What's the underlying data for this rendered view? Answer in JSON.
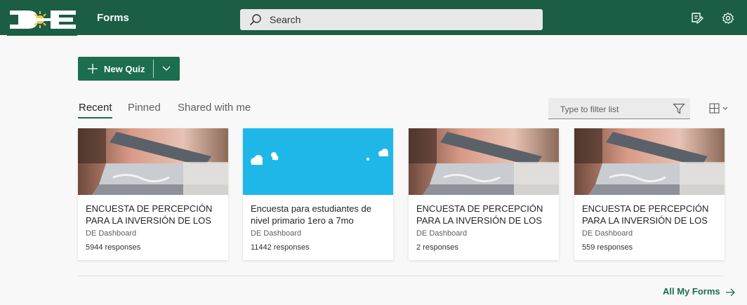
{
  "header": {
    "logo_text": "DE",
    "app_name": "Forms",
    "search_placeholder": "Search",
    "icons": [
      "feedback-icon",
      "settings-icon"
    ]
  },
  "actions": {
    "new_quiz_label": "New Quiz"
  },
  "tabs": [
    {
      "label": "Recent",
      "active": true
    },
    {
      "label": "Pinned",
      "active": false
    },
    {
      "label": "Shared with me",
      "active": false
    }
  ],
  "filter": {
    "placeholder": "Type to filter list"
  },
  "cards": [
    {
      "title": "ENCUESTA DE PERCEPCIÓN PARA LA INVERSIÓN DE LOS",
      "owner": "DE Dashboard",
      "responses": "5944 responses",
      "thumbnail": "laptop-photo"
    },
    {
      "title": "Encuesta para estudiantes de nivel primario 1ero a 7mo",
      "owner": "DE Dashboard",
      "responses": "11442 responses",
      "thumbnail": "sky-clouds"
    },
    {
      "title": "ENCUESTA DE PERCEPCIÓN PARA LA INVERSIÓN DE LOS",
      "owner": "DE Dashboard",
      "responses": "2 responses",
      "thumbnail": "laptop-photo"
    },
    {
      "title": "ENCUESTA DE PERCEPCIÓN PARA LA INVERSIÓN DE LOS",
      "owner": "DE Dashboard",
      "responses": "559 responses",
      "thumbnail": "laptop-photo"
    }
  ],
  "footer": {
    "all_forms_label": "All My Forms"
  },
  "colors": {
    "brand": "#1b5e44",
    "accent": "#1b6e4e",
    "sky": "#1fb7e8"
  }
}
